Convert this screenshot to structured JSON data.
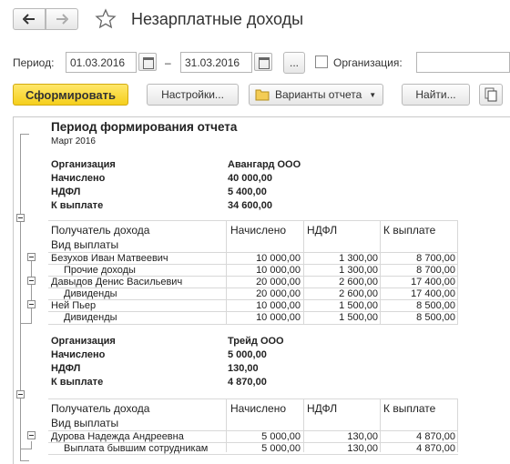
{
  "window": {
    "title": "Незарплатные доходы"
  },
  "toolbar": {
    "back_icon": "arrow-left-icon",
    "forward_icon": "arrow-right-icon",
    "favorite_icon": "star-icon"
  },
  "period": {
    "label": "Период:",
    "from": "01.03.2016",
    "to": "31.03.2016",
    "dash": "–",
    "more_label": "...",
    "org_label": "Организация:",
    "org_value": ""
  },
  "actions": {
    "generate": "Сформировать",
    "settings": "Настройки...",
    "variants": "Варианты отчета",
    "find": "Найти...",
    "copy_icon": "copy-icon"
  },
  "report": {
    "heading": "Период формирования отчета",
    "period": "Март 2016",
    "col_recipient": "Получатель дохода",
    "col_payment_type": "Вид выплаты",
    "col_accrued": "Начислено",
    "col_ndfl": "НДФЛ",
    "col_payout": "К выплате",
    "org_label": "Организация",
    "accrued_label": "Начислено",
    "ndfl_label": "НДФЛ",
    "payout_label": "К выплате",
    "groups": [
      {
        "org": "Авангард ООО",
        "accrued": "40 000,00",
        "ndfl": "5 400,00",
        "payout": "34 600,00",
        "rows": [
          {
            "name": "Безухов Иван Матвеевич",
            "accrued": "10 000,00",
            "ndfl": "1 300,00",
            "payout": "8 700,00"
          },
          {
            "name": "Прочие доходы",
            "accrued": "10 000,00",
            "ndfl": "1 300,00",
            "payout": "8 700,00"
          },
          {
            "name": "Давыдов Денис Васильевич",
            "accrued": "20 000,00",
            "ndfl": "2 600,00",
            "payout": "17 400,00"
          },
          {
            "name": "Дивиденды",
            "accrued": "20 000,00",
            "ndfl": "2 600,00",
            "payout": "17 400,00"
          },
          {
            "name": "Ней Пьер",
            "accrued": "10 000,00",
            "ndfl": "1 500,00",
            "payout": "8 500,00"
          },
          {
            "name": "Дивиденды",
            "accrued": "10 000,00",
            "ndfl": "1 500,00",
            "payout": "8 500,00"
          }
        ]
      },
      {
        "org": "Трейд ООО",
        "accrued": "5 000,00",
        "ndfl": "130,00",
        "payout": "4 870,00",
        "rows": [
          {
            "name": "Дурова Надежда Андреевна",
            "accrued": "5 000,00",
            "ndfl": "130,00",
            "payout": "4 870,00"
          },
          {
            "name": "Выплата бывшим сотрудникам",
            "accrued": "5 000,00",
            "ndfl": "130,00",
            "payout": "4 870,00"
          }
        ]
      }
    ]
  }
}
